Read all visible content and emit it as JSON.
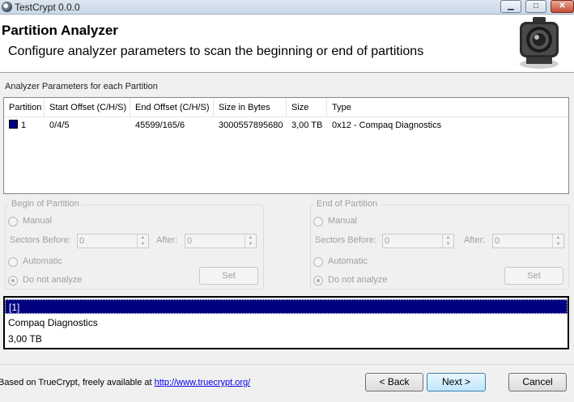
{
  "window": {
    "title": "TestCrypt 0.0.0",
    "minimize": "▁",
    "maximize": "□",
    "close": "✕"
  },
  "header": {
    "title": "Partition Analyzer",
    "subtitle": "Configure analyzer parameters to scan the beginning or end of partitions",
    "logo_icon": "camera-lens-icon"
  },
  "params": {
    "section_label": "Analyzer Parameters for each Partition",
    "columns": [
      "Partition",
      "Start Offset (C/H/S)",
      "End Offset (C/H/S)",
      "Size in Bytes",
      "Size",
      "Type"
    ],
    "rows": [
      {
        "partition": "1",
        "start": "0/4/5",
        "end": "45599/165/6",
        "bytes": "3000557895680",
        "size": "3,00 TB",
        "type": "0x12 - Compaq Diagnostics",
        "color": "#000080"
      }
    ]
  },
  "begin": {
    "label": "Begin of Partition",
    "manual": "Manual",
    "sectors_before": "Sectors Before:",
    "sectors_before_value": "0",
    "after": "After:",
    "after_value": "0",
    "automatic": "Automatic",
    "do_not_analyze": "Do not analyze",
    "set": "Set"
  },
  "end": {
    "label": "End of Partition",
    "manual": "Manual",
    "sectors_before": "Sectors Before:",
    "sectors_before_value": "0",
    "after": "After:",
    "after_value": "0",
    "automatic": "Automatic",
    "do_not_analyze": "Do not analyze",
    "set": "Set"
  },
  "info": {
    "lines": [
      "[1]",
      "Compaq Diagnostics",
      "3,00 TB"
    ]
  },
  "footer": {
    "text": "Based on TrueCrypt, freely available at ",
    "link": "http://www.truecrypt.org/",
    "back": "< Back",
    "next": "Next >",
    "cancel": "Cancel"
  }
}
